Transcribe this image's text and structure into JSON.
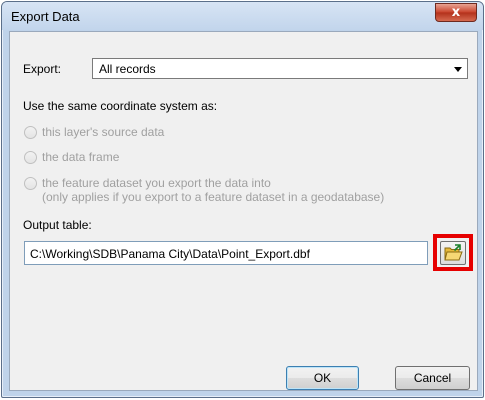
{
  "window": {
    "title": "Export Data",
    "close_label": "x"
  },
  "export": {
    "label": "Export:",
    "selected": "All records"
  },
  "coordinate": {
    "heading": "Use the same coordinate system as:",
    "options": [
      {
        "label": "this layer's source data",
        "enabled": false
      },
      {
        "label": "the data frame",
        "enabled": false
      },
      {
        "label": "the feature dataset you export the data into",
        "enabled": false
      }
    ],
    "option3_note": "(only applies if you export to a feature dataset in a geodatabase)"
  },
  "output": {
    "label": "Output table:",
    "value": "C:\\Working\\SDB\\Panama City\\Data\\Point_Export.dbf",
    "browse_icon": "folder-open-icon"
  },
  "buttons": {
    "ok": "OK",
    "cancel": "Cancel"
  },
  "colors": {
    "highlight": "#e60000",
    "close_button": "#c8412a",
    "window_frame": "#bfd3ea"
  }
}
